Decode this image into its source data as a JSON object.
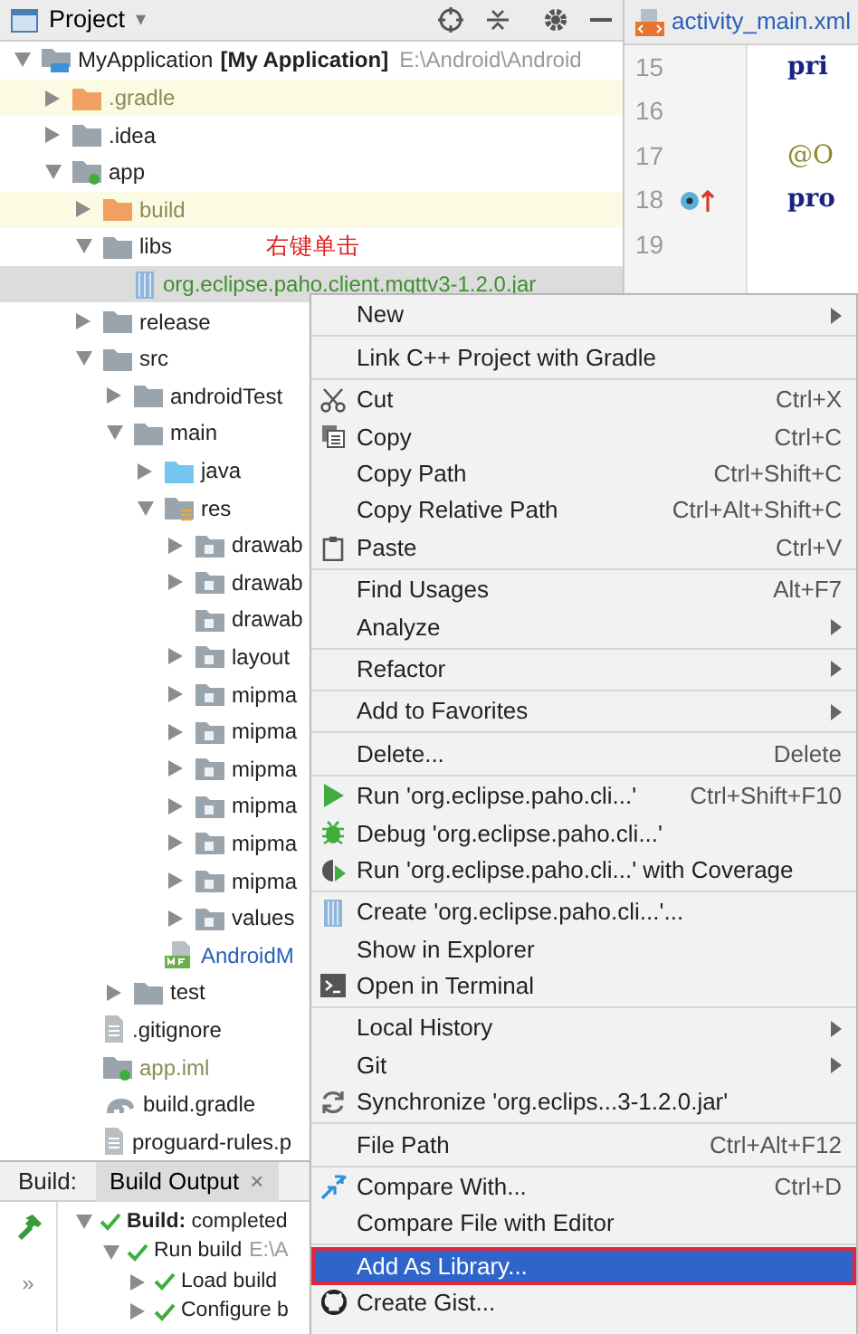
{
  "project_panel": {
    "title": "Project",
    "dropdown": "▾"
  },
  "tree": [
    {
      "label": "MyApplication",
      "module": "[My Application]",
      "path": "E:\\Android\\Android",
      "kind": "project",
      "expanded": true,
      "selected": false,
      "highlighted": false,
      "children": [
        {
          "label": ".gradle",
          "kind": "excluded",
          "expanded": false,
          "selected": false,
          "highlighted": true,
          "color": "#8b8b55"
        },
        {
          "label": ".idea",
          "kind": "folder",
          "expanded": false,
          "selected": false,
          "highlighted": false
        },
        {
          "label": "app",
          "kind": "module",
          "expanded": true,
          "selected": false,
          "highlighted": false,
          "children": [
            {
              "label": "build",
              "kind": "excluded",
              "expanded": false,
              "selected": false,
              "highlighted": true,
              "color": "#8b8b55"
            },
            {
              "label": "libs",
              "kind": "folder",
              "expanded": true,
              "selected": false,
              "highlighted": false,
              "annotation": "右键单击",
              "children": [
                {
                  "label": "org.eclipse.paho.client.mqttv3-1.2.0.jar",
                  "kind": "jar",
                  "selected": true,
                  "highlighted": false,
                  "color": "#3f8f2f"
                }
              ]
            },
            {
              "label": "release",
              "kind": "folder",
              "expanded": false,
              "selected": false,
              "highlighted": false
            },
            {
              "label": "src",
              "kind": "folder",
              "expanded": true,
              "selected": false,
              "highlighted": false,
              "children": [
                {
                  "label": "androidTest",
                  "kind": "folder",
                  "expanded": false,
                  "selected": false,
                  "highlighted": false
                },
                {
                  "label": "main",
                  "kind": "folder",
                  "expanded": true,
                  "selected": false,
                  "highlighted": false,
                  "children": [
                    {
                      "label": "java",
                      "kind": "source",
                      "expanded": false,
                      "selected": false,
                      "highlighted": false
                    },
                    {
                      "label": "res",
                      "kind": "res",
                      "expanded": true,
                      "selected": false,
                      "highlighted": false,
                      "children": [
                        {
                          "label": "drawab",
                          "kind": "resdir",
                          "expanded": false,
                          "selected": false,
                          "highlighted": false
                        },
                        {
                          "label": "drawab",
                          "kind": "resdir",
                          "expanded": false,
                          "selected": false,
                          "highlighted": false
                        },
                        {
                          "label": "drawab",
                          "kind": "resdir",
                          "selected": false,
                          "highlighted": false
                        },
                        {
                          "label": "layout",
                          "kind": "resdir",
                          "expanded": false,
                          "selected": false,
                          "highlighted": false
                        },
                        {
                          "label": "mipma",
                          "kind": "resdir",
                          "expanded": false,
                          "selected": false,
                          "highlighted": false
                        },
                        {
                          "label": "mipma",
                          "kind": "resdir",
                          "expanded": false,
                          "selected": false,
                          "highlighted": false
                        },
                        {
                          "label": "mipma",
                          "kind": "resdir",
                          "expanded": false,
                          "selected": false,
                          "highlighted": false
                        },
                        {
                          "label": "mipma",
                          "kind": "resdir",
                          "expanded": false,
                          "selected": false,
                          "highlighted": false
                        },
                        {
                          "label": "mipma",
                          "kind": "resdir",
                          "expanded": false,
                          "selected": false,
                          "highlighted": false
                        },
                        {
                          "label": "mipma",
                          "kind": "resdir",
                          "expanded": false,
                          "selected": false,
                          "highlighted": false
                        },
                        {
                          "label": "values",
                          "kind": "resdir",
                          "expanded": false,
                          "selected": false,
                          "highlighted": false
                        }
                      ]
                    },
                    {
                      "label": "AndroidM",
                      "kind": "manifest",
                      "selected": false,
                      "highlighted": false,
                      "color": "#2c5fb8"
                    }
                  ]
                },
                {
                  "label": "test",
                  "kind": "folder",
                  "expanded": false,
                  "selected": false,
                  "highlighted": false
                }
              ]
            },
            {
              "label": ".gitignore",
              "kind": "file",
              "selected": false,
              "highlighted": false
            },
            {
              "label": "app.iml",
              "kind": "iml",
              "selected": false,
              "highlighted": false,
              "color": "#8b8b55"
            },
            {
              "label": "build.gradle",
              "kind": "gradle",
              "selected": false,
              "highlighted": false
            },
            {
              "label": "proguard-rules.p",
              "kind": "file",
              "selected": false,
              "highlighted": false
            }
          ]
        }
      ]
    }
  ],
  "editor": {
    "tab": "activity_main.xml",
    "lines": [
      {
        "number": "15",
        "code": "pri"
      },
      {
        "number": "16"
      },
      {
        "number": "17",
        "code": "@O",
        "kind": "annotation"
      },
      {
        "number": "18",
        "code": "pro",
        "marker": true
      },
      {
        "number": "19"
      }
    ]
  },
  "build_panel": {
    "label": "Build:",
    "tabs": [
      {
        "label": "Build Output",
        "close": "×",
        "selected": true
      }
    ],
    "expand": "»",
    "items": [
      {
        "text": "**Build:** completed",
        "expanded": true,
        "children": [
          {
            "text": "Run build",
            "detail": "E:\\A",
            "expanded": true,
            "children": [
              {
                "text": "Load build",
                "expanded": false
              },
              {
                "text": "Configure b",
                "expanded": false
              }
            ]
          }
        ]
      }
    ]
  },
  "context_menu": {
    "groups": [
      {
        "items": [
          {
            "label": "New",
            "submenu": true,
            "selected": false
          }
        ]
      },
      {
        "items": [
          {
            "label": "Link C++ Project with Gradle",
            "selected": false
          }
        ]
      },
      {
        "items": [
          {
            "label": "Cut",
            "kind": "cut",
            "shortcut": "Ctrl+X",
            "selected": false
          },
          {
            "label": "Copy",
            "kind": "copy",
            "shortcut": "Ctrl+C",
            "selected": false
          },
          {
            "label": "Copy Path",
            "shortcut": "Ctrl+Shift+C",
            "selected": false
          },
          {
            "label": "Copy Relative Path",
            "shortcut": "Ctrl+Alt+Shift+C",
            "selected": false
          },
          {
            "label": "Paste",
            "kind": "paste",
            "shortcut": "Ctrl+V",
            "selected": false
          }
        ]
      },
      {
        "items": [
          {
            "label": "Find Usages",
            "shortcut": "Alt+F7",
            "selected": false
          },
          {
            "label": "Analyze",
            "submenu": true,
            "selected": false
          }
        ]
      },
      {
        "items": [
          {
            "label": "Refactor",
            "submenu": true,
            "selected": false
          }
        ]
      },
      {
        "items": [
          {
            "label": "Add to Favorites",
            "submenu": true,
            "selected": false
          }
        ]
      },
      {
        "items": [
          {
            "label": "Delete...",
            "shortcut": "Delete",
            "selected": false
          }
        ]
      },
      {
        "items": [
          {
            "label": "Run 'org.eclipse.paho.cli...'",
            "kind": "run",
            "shortcut": "Ctrl+Shift+F10",
            "selected": false
          },
          {
            "label": "Debug 'org.eclipse.paho.cli...'",
            "kind": "debug",
            "selected": false
          },
          {
            "label": "Run 'org.eclipse.paho.cli...' with Coverage",
            "kind": "coverage",
            "selected": false
          }
        ]
      },
      {
        "items": [
          {
            "label": "Create 'org.eclipse.paho.cli...'...",
            "kind": "jar",
            "selected": false
          },
          {
            "label": "Show in Explorer",
            "selected": false
          },
          {
            "label": "Open in Terminal",
            "kind": "terminal",
            "selected": false
          }
        ]
      },
      {
        "items": [
          {
            "label": "Local History",
            "submenu": true,
            "selected": false
          },
          {
            "label": "Git",
            "submenu": true,
            "selected": false
          },
          {
            "label": "Synchronize 'org.eclips...3-1.2.0.jar'",
            "kind": "sync",
            "selected": false
          }
        ]
      },
      {
        "items": [
          {
            "label": "File Path",
            "shortcut": "Ctrl+Alt+F12",
            "selected": false
          }
        ]
      },
      {
        "items": [
          {
            "label": "Compare With...",
            "kind": "compare",
            "shortcut": "Ctrl+D",
            "selected": false
          },
          {
            "label": "Compare File with Editor",
            "selected": false
          }
        ]
      },
      {
        "items": [
          {
            "label": "Add As Library...",
            "selected": true,
            "outlined": true
          },
          {
            "label": "Create Gist...",
            "kind": "github",
            "selected": false
          }
        ]
      }
    ]
  }
}
